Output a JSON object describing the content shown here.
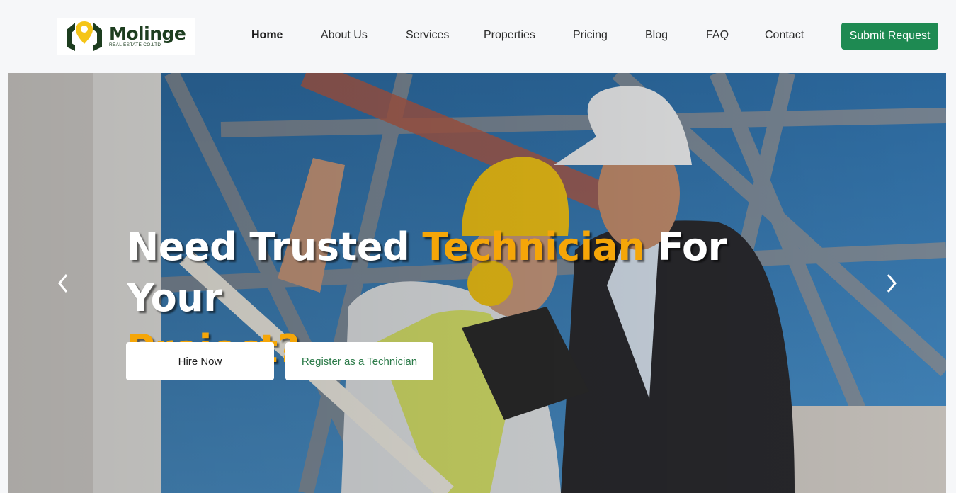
{
  "logo": {
    "name": "Molinge",
    "subtitle": "Real Estate Co.Ltd",
    "icon": "house-location-pin-icon"
  },
  "nav": {
    "items": [
      {
        "label": "Home",
        "active": true
      },
      {
        "label": "About Us",
        "active": false
      },
      {
        "label": "Services",
        "active": false
      },
      {
        "label": "Properties",
        "active": false
      },
      {
        "label": "Pricing",
        "active": false
      },
      {
        "label": "Blog",
        "active": false
      },
      {
        "label": "FAQ",
        "active": false
      },
      {
        "label": "Contact",
        "active": false
      }
    ],
    "cta_label": "Submit Request"
  },
  "hero": {
    "title_part1": "Need Trusted ",
    "title_accent1": "Technician",
    "title_part2": " For Your",
    "title_accent2": "Project?",
    "primary_button": "Hire Now",
    "secondary_button": "Register as a Technician",
    "prev_icon": "chevron-left-icon",
    "next_icon": "chevron-right-icon",
    "background": "construction-engineers-photo"
  },
  "colors": {
    "brand_green": "#1e8a52",
    "accent_orange": "#f5a608",
    "logo_dark_green": "#1d3d1f",
    "logo_yellow": "#f5c518"
  }
}
